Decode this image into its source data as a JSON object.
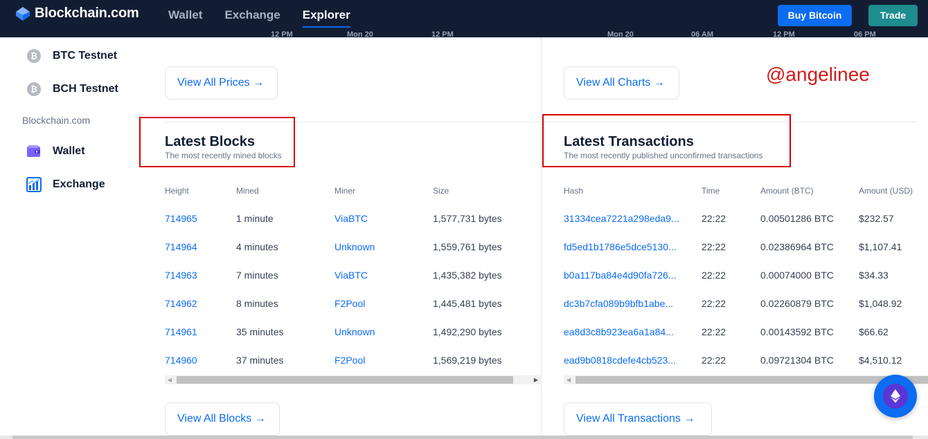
{
  "header": {
    "logo_text": "Blockchain.com",
    "nav": [
      {
        "label": "Wallet"
      },
      {
        "label": "Exchange"
      },
      {
        "label": "Explorer"
      }
    ],
    "buy_label": "Buy Bitcoin",
    "trade_label": "Trade",
    "colors": {
      "bar": "#121d33",
      "buy": "#0c6cf2",
      "trade": "#1f8c8e"
    }
  },
  "sidebar": {
    "items": [
      {
        "label": "BTC Testnet",
        "icon": "bitcoin-testnet-icon"
      },
      {
        "label": "BCH Testnet",
        "icon": "bitcoin-cash-testnet-icon"
      }
    ],
    "section_label": "Blockchain.com",
    "section_items": [
      {
        "label": "Wallet",
        "icon": "wallet-icon"
      },
      {
        "label": "Exchange",
        "icon": "exchange-chart-icon"
      }
    ]
  },
  "chart_axis_remnants": {
    "left": [
      "12 PM",
      "Mon 20",
      "12 PM"
    ],
    "right": [
      "Mon 20",
      "06 AM",
      "12 PM",
      "06 PM"
    ]
  },
  "buttons": {
    "view_prices": "View All Prices →",
    "view_charts": "View All Charts →",
    "view_blocks": "View All Blocks →",
    "view_transactions": "View All Transactions →"
  },
  "watermark": "@angelinee",
  "latest_blocks": {
    "title": "Latest Blocks",
    "subtitle": "The most recently mined blocks",
    "columns": [
      "Height",
      "Mined",
      "Miner",
      "Size"
    ],
    "rows": [
      {
        "height": "714965",
        "mined": "1 minute",
        "miner": "ViaBTC",
        "size": "1,577,731 bytes"
      },
      {
        "height": "714964",
        "mined": "4 minutes",
        "miner": "Unknown",
        "size": "1,559,761 bytes"
      },
      {
        "height": "714963",
        "mined": "7 minutes",
        "miner": "ViaBTC",
        "size": "1,435,382 bytes"
      },
      {
        "height": "714962",
        "mined": "8 minutes",
        "miner": "F2Pool",
        "size": "1,445,481 bytes"
      },
      {
        "height": "714961",
        "mined": "35 minutes",
        "miner": "Unknown",
        "size": "1,492,290 bytes"
      },
      {
        "height": "714960",
        "mined": "37 minutes",
        "miner": "F2Pool",
        "size": "1,569,219 bytes"
      }
    ]
  },
  "latest_transactions": {
    "title": "Latest Transactions",
    "subtitle": "The most recently published unconfirmed transactions",
    "columns": [
      "Hash",
      "Time",
      "Amount (BTC)",
      "Amount (USD)"
    ],
    "rows": [
      {
        "hash": "31334cea7221a298eda9...",
        "time": "22:22",
        "btc": "0.00501286 BTC",
        "usd": "$232.57"
      },
      {
        "hash": "fd5ed1b1786e5dce5130...",
        "time": "22:22",
        "btc": "0.02386964 BTC",
        "usd": "$1,107.41"
      },
      {
        "hash": "b0a117ba84e4d90fa726...",
        "time": "22:22",
        "btc": "0.00074000 BTC",
        "usd": "$34.33"
      },
      {
        "hash": "dc3b7cfa089b9bfb1abe...",
        "time": "22:22",
        "btc": "0.02260879 BTC",
        "usd": "$1,048.92"
      },
      {
        "hash": "ea8d3c8b923ea6a1a84...",
        "time": "22:22",
        "btc": "0.00143592 BTC",
        "usd": "$66.62"
      },
      {
        "hash": "ead9b0818cdefe4cb523...",
        "time": "22:22",
        "btc": "0.09721304 BTC",
        "usd": "$4,510.12"
      }
    ]
  }
}
